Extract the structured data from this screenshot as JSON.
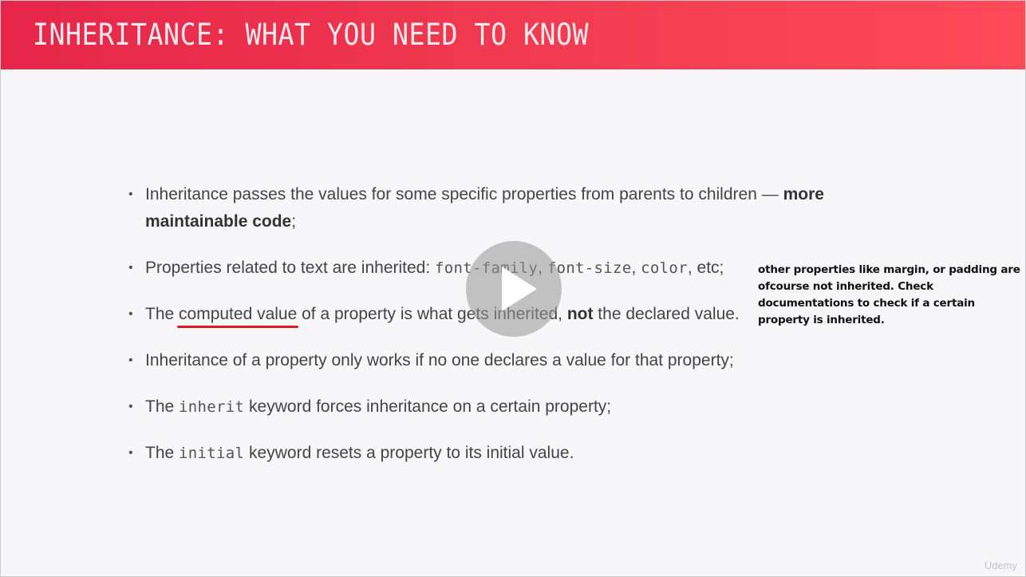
{
  "slide": {
    "title": "INHERITANCE: WHAT YOU NEED TO KNOW",
    "bullets": [
      {
        "text_before": "Inheritance passes the values for some specific properties from parents to children — ",
        "bold": "more maintainable code",
        "text_after": ";"
      },
      {
        "text_before": "Properties related to text are inherited: ",
        "code1": "font-family",
        "sep1": ", ",
        "code2": "font-size",
        "sep2": ", ",
        "code3": "color",
        "text_after": ", etc;"
      },
      {
        "text_before": "The ",
        "underlined": "computed value",
        "text_middle": " of a property is what gets inherited, ",
        "bold": "not",
        "text_after": " the declared value."
      },
      {
        "text": "Inheritance of a property only works if no one declares a value for that property;"
      },
      {
        "text_before": "The ",
        "code": "inherit",
        "text_after": " keyword forces inheritance on a certain property;"
      },
      {
        "text_before": "The ",
        "code": "initial",
        "text_after": " keyword resets a property to its initial value."
      }
    ],
    "bullet_glyph": "•"
  },
  "annotation": {
    "note": "other properties like margin, or padding are ofcourse not inherited. Check documentations to check if a certain property is inherited.",
    "underline_color": "#e01b1b"
  },
  "player": {
    "play_icon": "play-icon"
  },
  "watermark": "Üdemy",
  "colors": {
    "header_start": "#e5254a",
    "header_end": "#ff4a5a",
    "background": "#f7f6f8",
    "text": "#444444"
  }
}
